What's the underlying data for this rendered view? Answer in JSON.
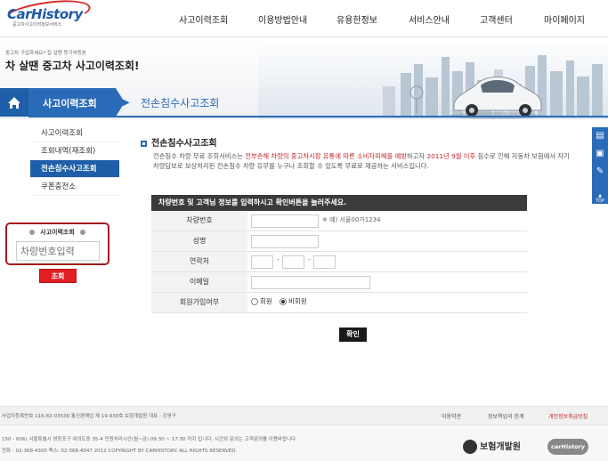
{
  "logo": {
    "name": "CarHistory",
    "sub": "중고차사고이력정보서비스"
  },
  "gnb": [
    {
      "label": "사고이력조회"
    },
    {
      "label": "이용방법안내"
    },
    {
      "label": "유용한정보"
    },
    {
      "label": "서비스안내"
    },
    {
      "label": "고객센터"
    },
    {
      "label": "마이페이지"
    }
  ],
  "hero": {
    "small": "중고차 구입하세요? 집 살땐 등기부등본",
    "big": "차 살땐 중고차 사고이력조회!"
  },
  "nav": {
    "category": "사고이력조회",
    "breadcrumb": "전손침수사고조회"
  },
  "sidebar": {
    "items": [
      {
        "label": "사고이력조회",
        "active": false
      },
      {
        "label": "조회내역(재조회)",
        "active": false
      },
      {
        "label": "전손침수사고조회",
        "active": true
      },
      {
        "label": "쿠폰충전소",
        "active": false
      }
    ]
  },
  "lookup": {
    "title": "사고이력조회",
    "placeholder": "차량번호입력",
    "button": "조회"
  },
  "main": {
    "heading": "전손침수사고조회",
    "desc_1": "전손침수 차량 무료 조회서비스는 ",
    "desc_red_1": "전부손해 차량의 중고차시장 유통에 따른 소비자피해를 예방",
    "desc_2": "하고자 ",
    "desc_red_2": "2011년 9월 이후",
    "desc_3": " 침수로 인해 자동차 보험에서 자기차량담보로 보상처리된 전손침수 차량 유무를 누구나 조회할 수 있도록 무료로 제공하는 서비스입니다."
  },
  "form": {
    "bar": "차량번호 및 고객님 정보를 입력하시고 확인버튼을 눌러주세요.",
    "car_label": "차량번호",
    "car_note": "※ 예) 서울00가1234",
    "name_label": "성명",
    "phone_label": "연락처",
    "email_label": "이메일",
    "member_label": "회원가입여부",
    "opt_member": "회원",
    "opt_nonmember": "비회원",
    "confirm": "확인"
  },
  "rtabs": {
    "top": "TOP"
  },
  "footer": {
    "info": "사업자등록번호 116-82-03536  통신판매업 제 19-930호 보험개발원 대표 : 강영구",
    "terms": "이용약관",
    "privacy_limit": "정보책임의 한계",
    "privacy": "개인정보취급방침",
    "addr": "150 - 606) 서울특별시 영등포구 여의도동 35-4   민원처리시간(월~금) 09:30 ~ 17:30 까지 입니다. 시간외 문의는 고객문의를 이용바랍니다.",
    "copy": "전화 : 02-368-4300 팩스: 02-368-4047    2012 COPYRIGHT BY CARHISTORY. ALL RIGHTS RESERVED.",
    "org": "보험개발원",
    "brand": "carHistory"
  },
  "colors": {
    "brand_blue": "#2a6bb8",
    "brand_red": "#e21e25",
    "bar_dark": "#3b3b3b"
  }
}
